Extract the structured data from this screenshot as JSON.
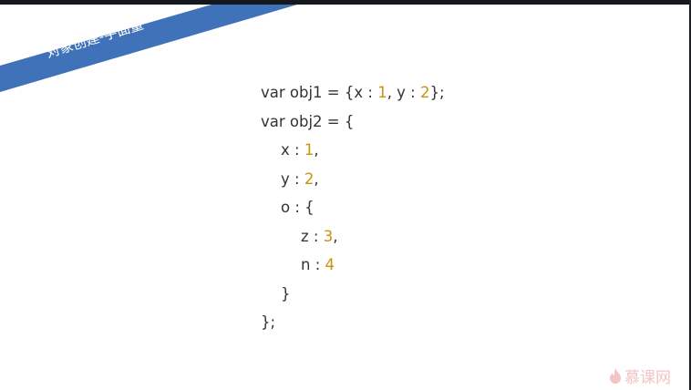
{
  "slide_title": "对象创建-字面量",
  "code_lines": [
    {
      "indent": 0,
      "parts": [
        [
          "var obj1 = {x : ",
          ""
        ],
        [
          "1",
          "n"
        ],
        [
          ", y : ",
          ""
        ],
        [
          "2",
          "n"
        ],
        [
          "};",
          ""
        ]
      ]
    },
    {
      "indent": 0,
      "parts": [
        [
          "var obj2 = {",
          ""
        ]
      ]
    },
    {
      "indent": 1,
      "parts": [
        [
          "x : ",
          ""
        ],
        [
          "1",
          "n"
        ],
        [
          ",",
          ""
        ]
      ]
    },
    {
      "indent": 1,
      "parts": [
        [
          "y : ",
          ""
        ],
        [
          "2",
          "n"
        ],
        [
          ",",
          ""
        ]
      ]
    },
    {
      "indent": 1,
      "parts": [
        [
          "o : {",
          ""
        ]
      ]
    },
    {
      "indent": 2,
      "parts": [
        [
          "z : ",
          ""
        ],
        [
          "3",
          "n"
        ],
        [
          ",",
          ""
        ]
      ]
    },
    {
      "indent": 2,
      "parts": [
        [
          "n : ",
          ""
        ],
        [
          "4",
          "n"
        ]
      ]
    },
    {
      "indent": 1,
      "parts": [
        [
          "}",
          ""
        ]
      ]
    },
    {
      "indent": 0,
      "parts": [
        [
          "};",
          ""
        ]
      ]
    }
  ],
  "logo_text": "慕课网",
  "colors": {
    "banner": "#3f72b8",
    "number": "#c8920a",
    "logo": "#f2c4c4"
  }
}
